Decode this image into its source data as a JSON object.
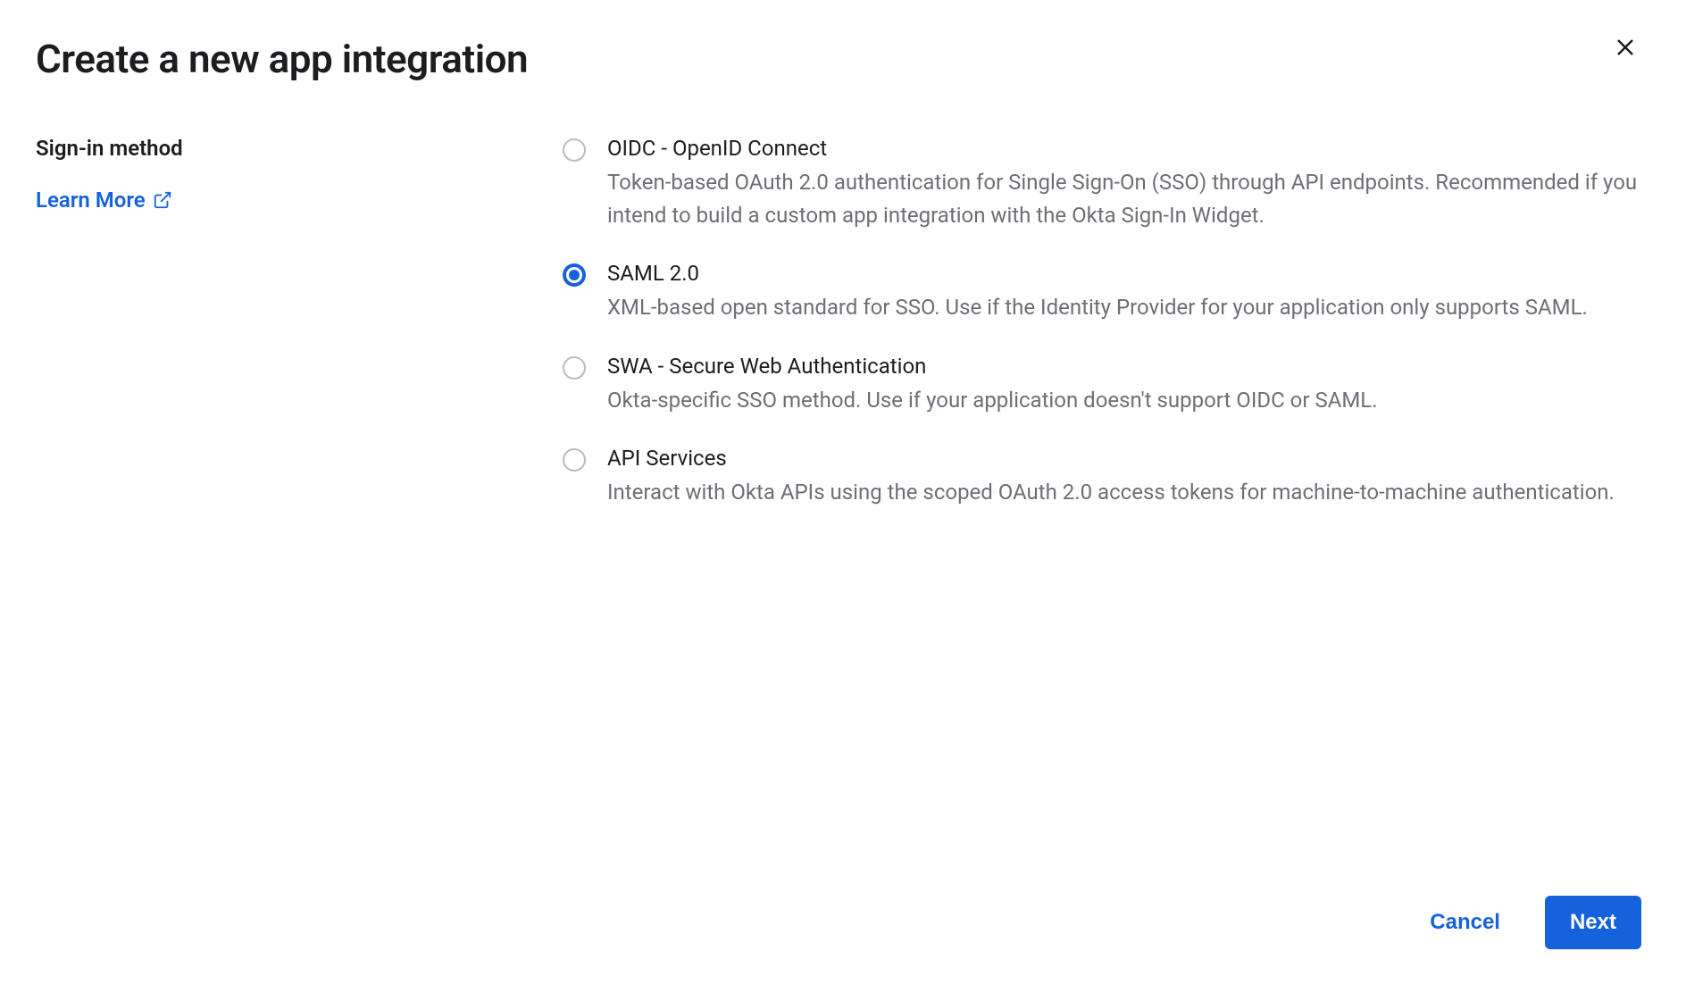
{
  "modal": {
    "title": "Create a new app integration",
    "section_label": "Sign-in method",
    "learn_more": "Learn More",
    "selected_index": 1,
    "options": [
      {
        "title": "OIDC - OpenID Connect",
        "description": "Token-based OAuth 2.0 authentication for Single Sign-On (SSO) through API endpoints. Recommended if you intend to build a custom app integration with the Okta Sign-In Widget."
      },
      {
        "title": "SAML 2.0",
        "description": "XML-based open standard for SSO. Use if the Identity Provider for your application only supports SAML."
      },
      {
        "title": "SWA - Secure Web Authentication",
        "description": "Okta-specific SSO method. Use if your application doesn't support OIDC or SAML."
      },
      {
        "title": "API Services",
        "description": "Interact with Okta APIs using the scoped OAuth 2.0 access tokens for machine-to-machine authentication."
      }
    ],
    "buttons": {
      "cancel": "Cancel",
      "next": "Next"
    }
  }
}
